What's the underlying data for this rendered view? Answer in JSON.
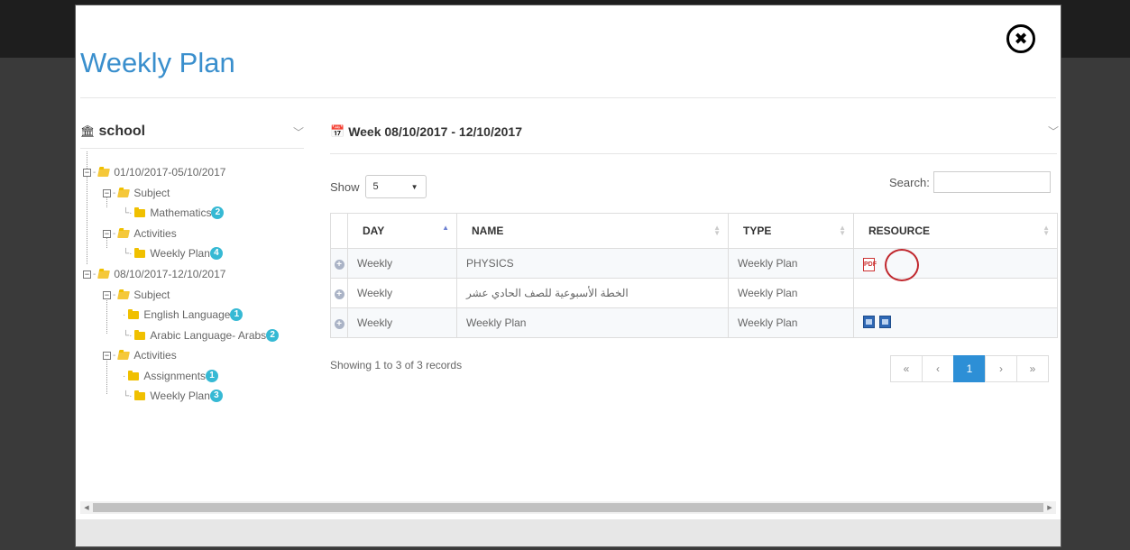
{
  "modal": {
    "title": "Weekly Plan",
    "close_icon": "close-circle-icon"
  },
  "left_panel": {
    "title": "school",
    "icon": "bank-icon",
    "collapse_icon": "chevron-down-icon",
    "tree": [
      {
        "label": "01/10/2017-05/10/2017"
      },
      {
        "label": "Subject"
      },
      {
        "label": "Mathematics",
        "badge": "2"
      },
      {
        "label": "Activities"
      },
      {
        "label": "Weekly Plan",
        "badge": "4"
      },
      {
        "label": "08/10/2017-12/10/2017"
      },
      {
        "label": "Subject"
      },
      {
        "label": "English Language",
        "badge": "1"
      },
      {
        "label": "Arabic Language- Arabs",
        "badge": "2"
      },
      {
        "label": "Activities"
      },
      {
        "label": "Assignments",
        "badge": "1"
      },
      {
        "label": "Weekly Plan",
        "badge": "3"
      }
    ]
  },
  "right_panel": {
    "title": "Week 08/10/2017 - 12/10/2017",
    "icon": "calendar-icon",
    "collapse_icon": "chevron-down-icon",
    "show_label": "Show",
    "page_size": "5",
    "search_label": "Search:",
    "search_value": "",
    "columns": [
      "DAY",
      "NAME",
      "TYPE",
      "RESOURCE"
    ],
    "rows": [
      {
        "day": "Weekly",
        "name": "PHYSICS",
        "type": "Weekly Plan",
        "resources": [
          "pdf-icon"
        ]
      },
      {
        "day": "Weekly",
        "name": "الخطة الأسبوعية للصف الحادي عشر",
        "type": "Weekly Plan",
        "resources": []
      },
      {
        "day": "Weekly",
        "name": "Weekly Plan",
        "type": "Weekly Plan",
        "resources": [
          "word-doc-icon",
          "word-doc-icon"
        ]
      }
    ],
    "info": "Showing 1 to 3 of 3 records",
    "pagination": {
      "first": "«",
      "prev": "‹",
      "current": "1",
      "next": "›",
      "last": "»"
    }
  },
  "colors": {
    "title": "#3a8fcd",
    "badge": "#36b9d4",
    "folder": "#f0c000",
    "active_page": "#2d8fd6",
    "highlight_ring": "#c0272d"
  }
}
